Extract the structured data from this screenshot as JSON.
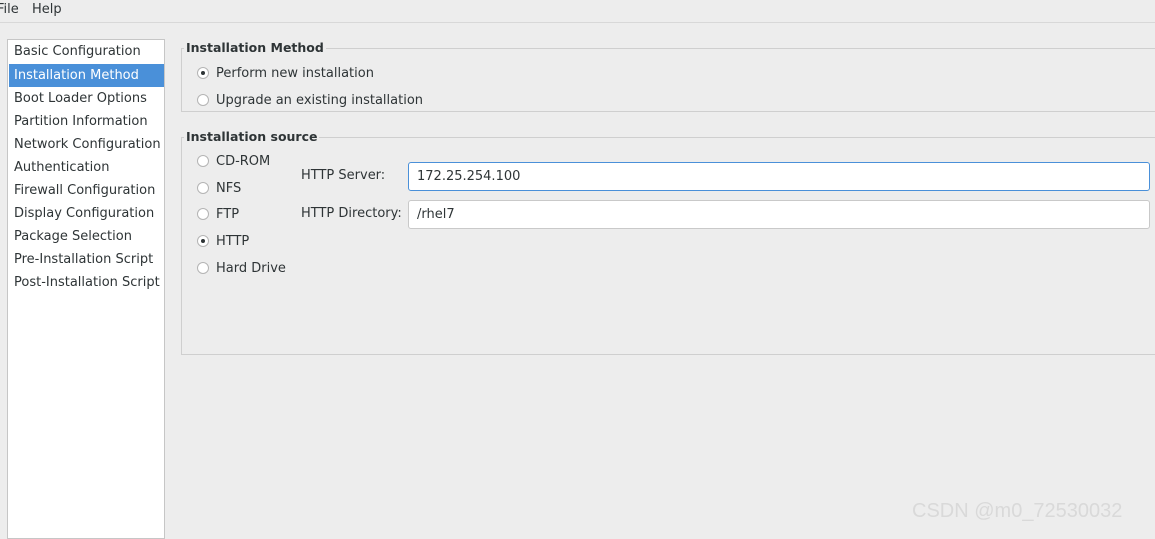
{
  "menubar": {
    "file_label": "File",
    "help_label": "Help"
  },
  "sidebar": {
    "items": [
      {
        "label": "Basic Configuration",
        "selected": false
      },
      {
        "label": "Installation Method",
        "selected": true
      },
      {
        "label": "Boot Loader Options",
        "selected": false
      },
      {
        "label": "Partition Information",
        "selected": false
      },
      {
        "label": "Network Configuration",
        "selected": false
      },
      {
        "label": "Authentication",
        "selected": false
      },
      {
        "label": "Firewall Configuration",
        "selected": false
      },
      {
        "label": "Display Configuration",
        "selected": false
      },
      {
        "label": "Package Selection",
        "selected": false
      },
      {
        "label": "Pre-Installation Script",
        "selected": false
      },
      {
        "label": "Post-Installation Script",
        "selected": false
      }
    ]
  },
  "installation_method": {
    "title": "Installation Method",
    "options": [
      {
        "label": "Perform new installation",
        "checked": true
      },
      {
        "label": "Upgrade an existing installation",
        "checked": false
      }
    ]
  },
  "installation_source": {
    "title": "Installation source",
    "options": [
      {
        "label": "CD-ROM",
        "checked": false
      },
      {
        "label": "NFS",
        "checked": false
      },
      {
        "label": "FTP",
        "checked": false
      },
      {
        "label": "HTTP",
        "checked": true
      },
      {
        "label": "Hard Drive",
        "checked": false
      }
    ],
    "http_server": {
      "label": "HTTP Server:",
      "value": "172.25.254.100"
    },
    "http_directory": {
      "label": "HTTP Directory:",
      "value": "/rhel7"
    }
  },
  "watermark": "CSDN @m0_72530032",
  "colors": {
    "selection": "#4a90d9",
    "window_bg": "#ededed"
  }
}
